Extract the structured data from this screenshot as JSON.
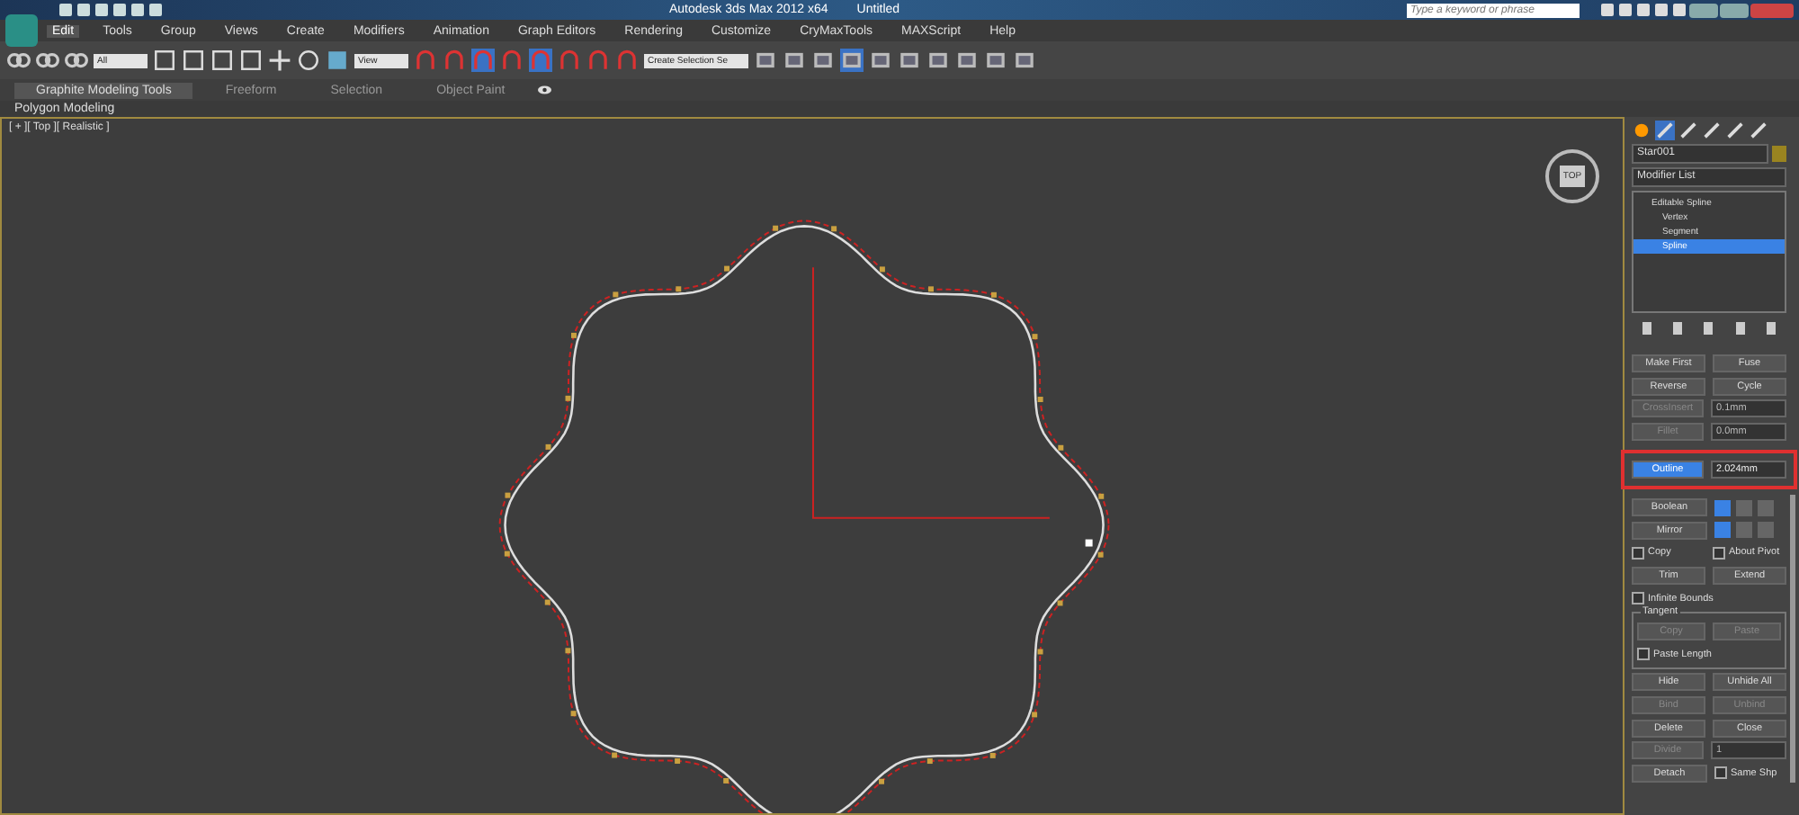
{
  "window": {
    "title": "Autodesk 3ds Max  2012 x64",
    "document": "Untitled",
    "search": {
      "placeholder": "Type a keyword or phrase"
    }
  },
  "menu": [
    {
      "label": "Edit",
      "selected": true
    },
    {
      "label": "Tools",
      "selected": false
    },
    {
      "label": "Group",
      "selected": false
    },
    {
      "label": "Views",
      "selected": false
    },
    {
      "label": "Create",
      "selected": false
    },
    {
      "label": "Modifiers",
      "selected": false
    },
    {
      "label": "Animation",
      "selected": false
    },
    {
      "label": "Graph Editors",
      "selected": false
    },
    {
      "label": "Rendering",
      "selected": false
    },
    {
      "label": "Customize",
      "selected": false
    },
    {
      "label": "CryMaxTools",
      "selected": false
    },
    {
      "label": "MAXScript",
      "selected": false
    },
    {
      "label": "Help",
      "selected": false
    }
  ],
  "toolbar": {
    "selection_filter": "All",
    "reference_system": "View",
    "named_selection": "Create Selection Se"
  },
  "ribbon": {
    "tabs": [
      {
        "label": "Graphite Modeling Tools",
        "selected": true
      },
      {
        "label": "Freeform",
        "selected": false
      },
      {
        "label": "Selection",
        "selected": false
      },
      {
        "label": "Object Paint",
        "selected": false
      }
    ],
    "panel": "Polygon Modeling"
  },
  "viewport": {
    "label": "[ + ][ Top ][ Realistic ]",
    "viewcube": "TOP"
  },
  "command_panel": {
    "object_name": "Star001",
    "modifier_list": "Modifier List",
    "stack": [
      {
        "label": "Editable Spline",
        "selected": false,
        "children": [
          {
            "label": "Vertex",
            "selected": false
          },
          {
            "label": "Segment",
            "selected": false
          },
          {
            "label": "Spline",
            "selected": true
          }
        ]
      }
    ],
    "rows": [
      {
        "kind": "pair",
        "items": [
          {
            "kind": "button",
            "label": "Make First",
            "disabled": false,
            "active": false
          },
          {
            "kind": "button",
            "label": "Fuse",
            "disabled": false,
            "active": false
          }
        ]
      },
      {
        "kind": "pair",
        "items": [
          {
            "kind": "button",
            "label": "Reverse",
            "disabled": false,
            "active": false
          },
          {
            "kind": "button",
            "label": "Cycle",
            "disabled": false,
            "active": false
          }
        ]
      },
      {
        "kind": "pair",
        "items": [
          {
            "kind": "button",
            "label": "CrossInsert",
            "disabled": true,
            "active": false
          },
          {
            "kind": "spinner",
            "value": "0.1mm",
            "disabled": true
          }
        ]
      },
      {
        "kind": "pair",
        "items": [
          {
            "kind": "button",
            "label": "Fillet",
            "disabled": true,
            "active": false
          },
          {
            "kind": "spinner",
            "value": "0.0mm",
            "disabled": true
          }
        ]
      },
      {
        "kind": "gap"
      },
      {
        "kind": "pair",
        "highlighted": true,
        "items": [
          {
            "kind": "button",
            "label": "Outline",
            "disabled": false,
            "active": true
          },
          {
            "kind": "spinner",
            "value": "2.024mm",
            "disabled": false
          }
        ]
      },
      {
        "kind": "gap"
      },
      {
        "kind": "pair",
        "items": [
          {
            "kind": "button",
            "label": "Boolean",
            "disabled": false,
            "active": false
          },
          {
            "kind": "icons",
            "icons": [
              {
                "selected": true
              },
              {
                "selected": false
              },
              {
                "selected": false
              }
            ]
          }
        ]
      },
      {
        "kind": "pair",
        "items": [
          {
            "kind": "button",
            "label": "Mirror",
            "disabled": false,
            "active": false
          },
          {
            "kind": "icons",
            "icons": [
              {
                "selected": true
              },
              {
                "selected": false
              },
              {
                "selected": false
              }
            ]
          }
        ]
      },
      {
        "kind": "pair",
        "items": [
          {
            "kind": "checkbox",
            "label": "Copy",
            "checked": false
          },
          {
            "kind": "checkbox",
            "label": "About Pivot",
            "checked": false
          }
        ]
      },
      {
        "kind": "pair",
        "items": [
          {
            "kind": "button",
            "label": "Trim",
            "disabled": false,
            "active": false
          },
          {
            "kind": "button",
            "label": "Extend",
            "disabled": false,
            "active": false
          }
        ]
      },
      {
        "kind": "pair",
        "items": [
          {
            "kind": "checkbox",
            "label": "Infinite Bounds",
            "checked": false
          }
        ]
      },
      {
        "kind": "group",
        "title": "Tangent",
        "rows": [
          {
            "kind": "pair",
            "items": [
              {
                "kind": "button",
                "label": "Copy",
                "disabled": true,
                "active": false
              },
              {
                "kind": "button",
                "label": "Paste",
                "disabled": true,
                "active": false
              }
            ]
          },
          {
            "kind": "pair",
            "items": [
              {
                "kind": "checkbox",
                "label": "Paste Length",
                "checked": false
              }
            ]
          }
        ]
      },
      {
        "kind": "pair",
        "items": [
          {
            "kind": "button",
            "label": "Hide",
            "disabled": false,
            "active": false
          },
          {
            "kind": "button",
            "label": "Unhide All",
            "disabled": false,
            "active": false
          }
        ]
      },
      {
        "kind": "pair",
        "items": [
          {
            "kind": "button",
            "label": "Bind",
            "disabled": true,
            "active": false
          },
          {
            "kind": "button",
            "label": "Unbind",
            "disabled": true,
            "active": false
          }
        ]
      },
      {
        "kind": "pair",
        "items": [
          {
            "kind": "button",
            "label": "Delete",
            "disabled": false,
            "active": false
          },
          {
            "kind": "button",
            "label": "Close",
            "disabled": false,
            "active": false
          }
        ]
      },
      {
        "kind": "pair",
        "items": [
          {
            "kind": "button",
            "label": "Divide",
            "disabled": true,
            "active": false
          },
          {
            "kind": "spinner",
            "value": "1",
            "disabled": true
          }
        ]
      },
      {
        "kind": "pair",
        "items": [
          {
            "kind": "button",
            "label": "Detach",
            "disabled": false,
            "active": false
          },
          {
            "kind": "checkbox",
            "label": "Same Shp",
            "checked": false
          }
        ]
      }
    ]
  }
}
